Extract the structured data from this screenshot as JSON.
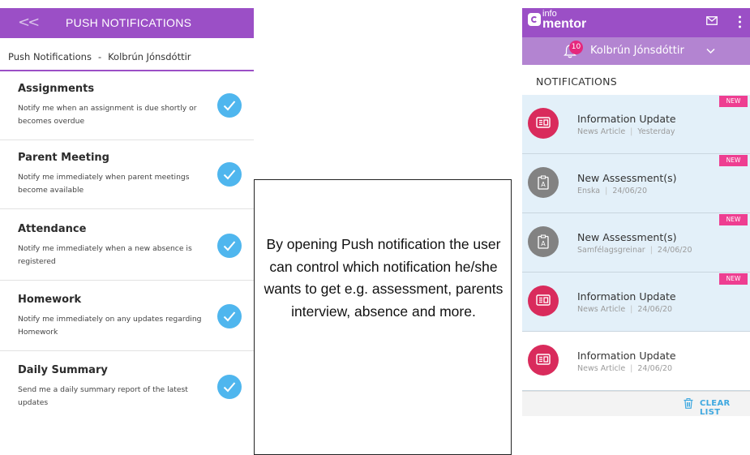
{
  "left_app": {
    "header": {
      "back_label": "<<",
      "title": "PUSH NOTIFICATIONS"
    },
    "breadcrumb": {
      "section": "Push Notifications",
      "separator": "-",
      "user": "Kolbrún Jónsdóttir"
    },
    "settings": [
      {
        "name": "Assignments",
        "description": "Notify me when an assignment is due shortly or becomes overdue",
        "checked": true
      },
      {
        "name": "Parent Meeting",
        "description": "Notify me immediately when parent meetings become available",
        "checked": true
      },
      {
        "name": "Attendance",
        "description": "Notify me immediately when a new absence is registered",
        "checked": true
      },
      {
        "name": "Homework",
        "description": "Notify me immediately on any updates regarding Homework",
        "checked": true
      },
      {
        "name": "Daily Summary",
        "description": "Send me a daily summary report of the latest updates",
        "checked": true
      }
    ],
    "accent_color": "#9b4fc6",
    "check_color": "#4fb6ee"
  },
  "callout": {
    "text": "By opening Push notification the user can control which notification he/she wants to get e.g. assessment, parents interview, absence and more."
  },
  "right_app": {
    "logo": {
      "top": "info",
      "bottom": "mentor"
    },
    "icons": {
      "mail": "mail-icon",
      "menu": "kebab-menu-icon",
      "bell": "bell-icon",
      "dropdown": "chevron-down-icon",
      "trash": "trash-icon"
    },
    "bell_count": "10",
    "user_name": "Kolbrún Jónsdóttir",
    "heading": "NOTIFICATIONS",
    "notifications": [
      {
        "title": "Information Update",
        "category": "News Article",
        "date": "Yesterday",
        "badge": "NEW",
        "icon": "news-icon"
      },
      {
        "title": "New Assessment(s)",
        "category": "Enska",
        "date": "24/06/20",
        "badge": "NEW",
        "icon": "assessment-icon"
      },
      {
        "title": "New Assessment(s)",
        "category": "Samfélagsgreinar",
        "date": "24/06/20",
        "badge": "NEW",
        "icon": "assessment-icon"
      },
      {
        "title": "Information Update",
        "category": "News Article",
        "date": "24/06/20",
        "badge": "NEW",
        "icon": "news-icon"
      },
      {
        "title": "Information Update",
        "category": "News Article",
        "date": "24/06/20",
        "badge": "",
        "icon": "news-icon"
      }
    ],
    "clear_label": "CLEAR LIST",
    "colors": {
      "unread_bg": "#e3f0f9",
      "badge": "#ee3e91",
      "news_icon": "#d92b5c",
      "assessment_icon": "#828282"
    }
  }
}
